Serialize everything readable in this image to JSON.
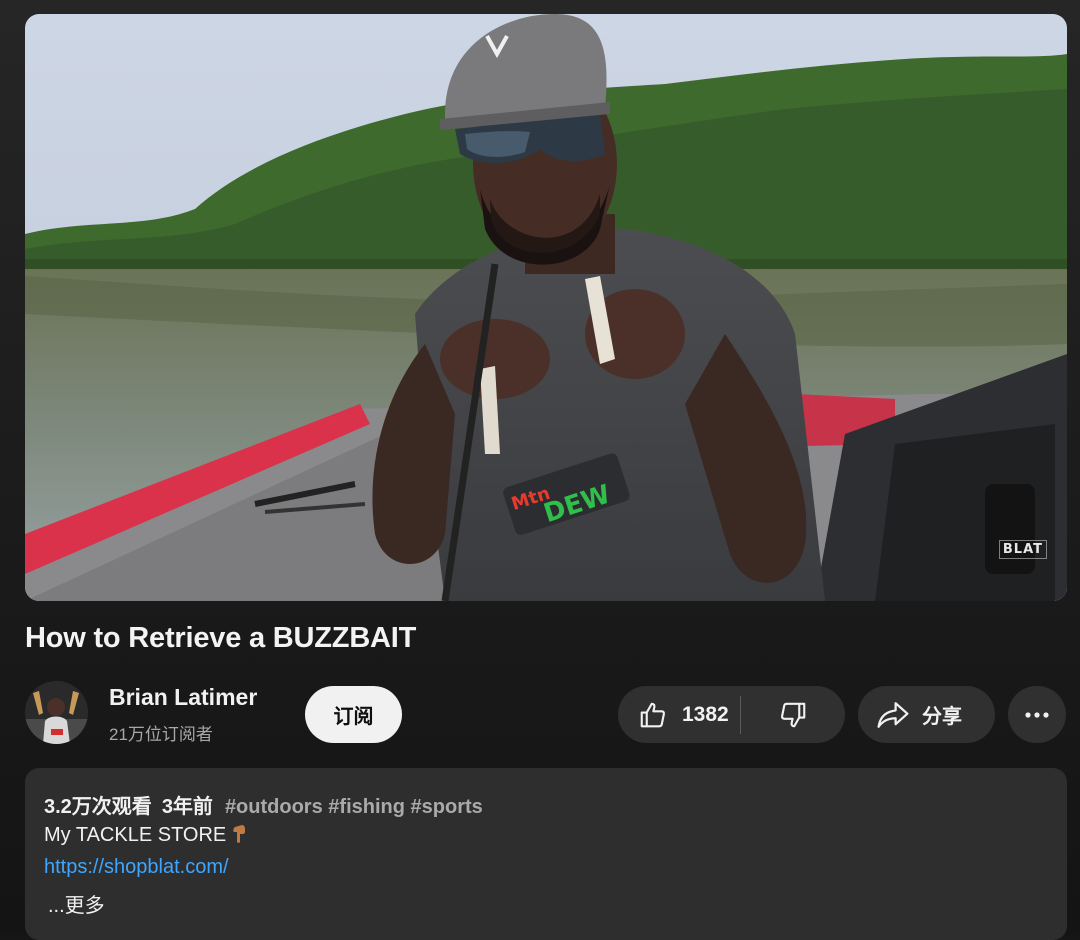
{
  "video": {
    "title": "How to Retrieve a BUZZBAIT",
    "watermark": "BLAT"
  },
  "channel": {
    "name": "Brian Latimer",
    "subscribers": "21万位订阅者",
    "subscribe_label": "订阅"
  },
  "actions": {
    "like_count": "1382",
    "share_label": "分享"
  },
  "description": {
    "views": "3.2万次观看",
    "age": "3年前",
    "hashtags": [
      "#outdoors",
      "#fishing",
      "#sports"
    ],
    "line1": "My TACKLE STORE",
    "link": "https://shopblat.com/",
    "more_label": "...更多"
  },
  "colors": {
    "background": "#161616",
    "pill": "#303030",
    "link": "#3ea6ff",
    "subscribe_bg": "#f1f1f1"
  },
  "icons": [
    "thumbs-up-icon",
    "thumbs-down-icon",
    "share-arrow-icon",
    "more-dots-icon",
    "pointing-down-hand-icon"
  ]
}
